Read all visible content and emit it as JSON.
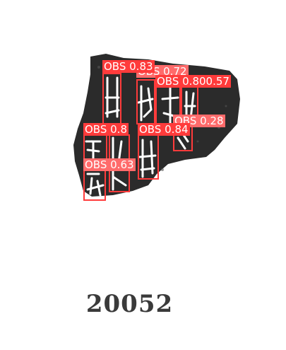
{
  "image": {
    "catalog_number": "20052",
    "rubbing_color": "#2b2b2b",
    "glyph_color": "#ffffff"
  },
  "detections": {
    "box_color": "#ff3b3b",
    "label_color": "#ffffff",
    "items": [
      {
        "label": "OBS",
        "confidence": "0.83"
      },
      {
        "label": "OBS",
        "confidence": "0.72"
      },
      {
        "label": "OBS",
        "confidence": "0.80"
      },
      {
        "label": "OBS",
        "confidence": "0.57"
      },
      {
        "label": "OBS",
        "confidence": "0.28"
      },
      {
        "label": "OBS",
        "confidence": "0.8"
      },
      {
        "label": "OBS",
        "confidence": "0.84"
      },
      {
        "label": "OBS",
        "confidence": "0.63"
      }
    ]
  }
}
